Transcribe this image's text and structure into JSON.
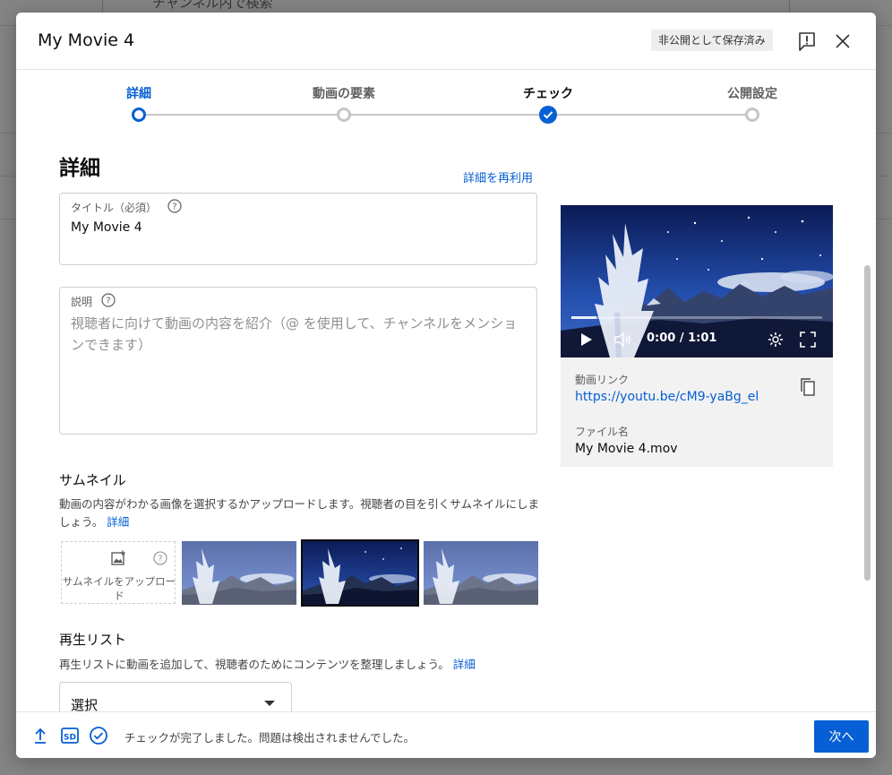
{
  "background": {
    "search_placeholder": "チャンネル内で検索"
  },
  "dialog": {
    "title": "My Movie 4",
    "saved_badge": "非公開として保存済み"
  },
  "stepper": {
    "steps": [
      {
        "label": "詳細",
        "state": "active"
      },
      {
        "label": "動画の要素",
        "state": "pending"
      },
      {
        "label": "チェック",
        "state": "done"
      },
      {
        "label": "公開設定",
        "state": "pending"
      }
    ]
  },
  "details": {
    "heading": "詳細",
    "reuse_link": "詳細を再利用",
    "title_field": {
      "label": "タイトル（必須）",
      "value": "My Movie 4"
    },
    "description_field": {
      "label": "説明",
      "placeholder": "視聴者に向けて動画の内容を紹介（@ を使用して、チャンネルをメンションできます）"
    },
    "thumbnail": {
      "heading": "サムネイル",
      "description": "動画の内容がわかる画像を選択するかアップロードします。視聴者の目を引くサムネイルにしましょう。",
      "link": "詳細",
      "upload_label": "サムネイルをアップロード"
    },
    "playlist": {
      "heading": "再生リスト",
      "description": "再生リストに動画を追加して、視聴者のためにコンテンツを整理しましょう。",
      "link": "詳細",
      "select_value": "選択"
    }
  },
  "video_card": {
    "time": "0:00 / 1:01",
    "progress_fraction": 0.1,
    "link_label": "動画リンク",
    "link": "https://youtu.be/cM9-yaBg_el",
    "file_label": "ファイル名",
    "file_name": "My Movie 4.mov"
  },
  "footer": {
    "status": "チェックが完了しました。問題は検出されませんでした。",
    "next_button": "次へ"
  },
  "colors": {
    "accent": "#065fd4",
    "overlay": "rgba(0,0,0,0.48)"
  }
}
